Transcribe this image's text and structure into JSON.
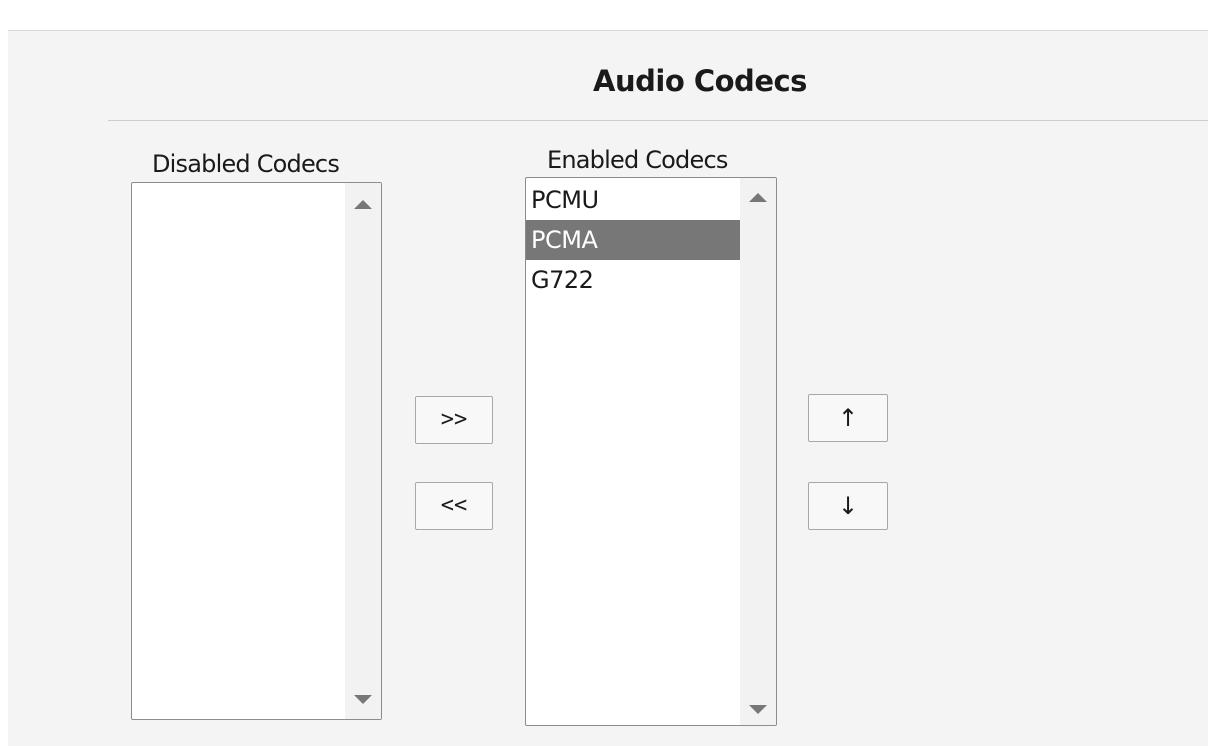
{
  "section": {
    "title": "Audio Codecs"
  },
  "disabled_list": {
    "label": "Disabled Codecs",
    "items": []
  },
  "enabled_list": {
    "label": "Enabled Codecs",
    "items": [
      "PCMU",
      "PCMA",
      "G722"
    ],
    "selected": "PCMA"
  },
  "transfer_buttons": {
    "add_label": ">>",
    "remove_label": "<<"
  },
  "order_buttons": {
    "up_label": "↑",
    "down_label": "↓"
  },
  "colors": {
    "background": "#f4f4f4",
    "selected_highlight": "#777777",
    "divider": "#c5ced6"
  }
}
